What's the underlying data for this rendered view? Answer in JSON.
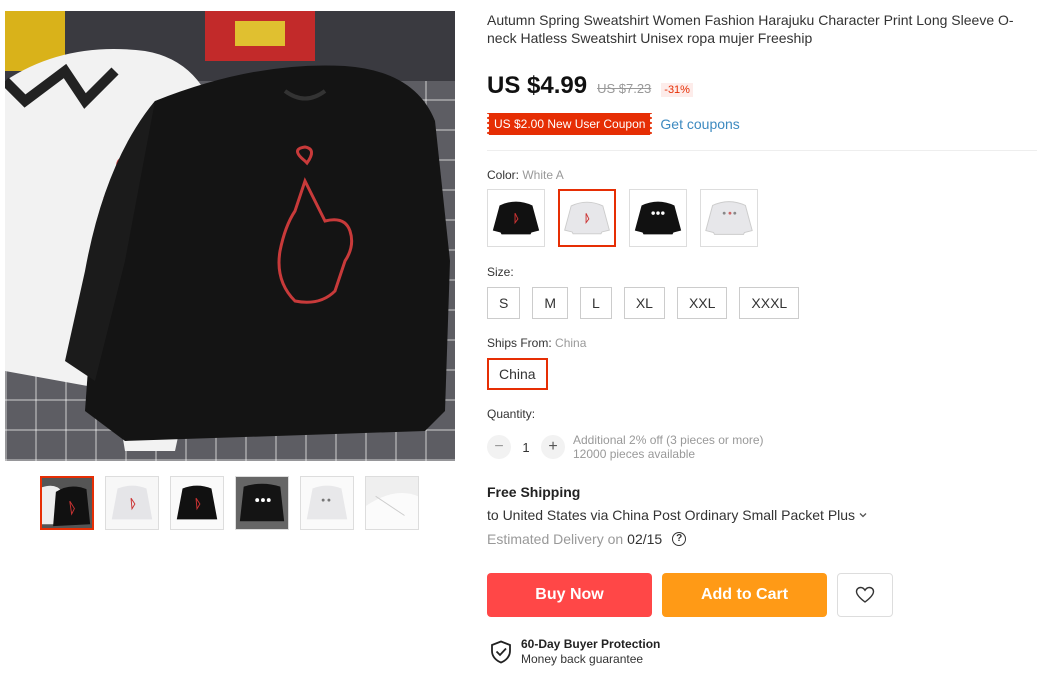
{
  "product": {
    "title": "Autumn Spring Sweatshirt Women Fashion Harajuku Character Print Long Sleeve O-neck Hatless Sweatshirt Unisex ropa mujer Freeship"
  },
  "price": {
    "current": "US $4.99",
    "original": "US $7.23",
    "discount": "-31%"
  },
  "coupon": {
    "tag": "US $2.00 New User Coupon",
    "link": "Get coupons"
  },
  "color": {
    "label": "Color:",
    "selected": "White A",
    "options": [
      "black-heart",
      "white-a",
      "black-print",
      "white-print"
    ]
  },
  "size": {
    "label": "Size:",
    "options": [
      "S",
      "M",
      "L",
      "XL",
      "XXL",
      "XXXL"
    ]
  },
  "ships_from": {
    "label": "Ships From:",
    "selected": "China",
    "option": "China"
  },
  "quantity": {
    "label": "Quantity:",
    "value": "1",
    "minus": "−",
    "plus": "+",
    "discount_note": "Additional 2% off (3 pieces or more)",
    "available": "12000 pieces available"
  },
  "shipping": {
    "title": "Free Shipping",
    "detail": "to United States via China Post Ordinary Small Packet Plus",
    "estimated_prefix": "Estimated Delivery on",
    "estimated_date": "02/15",
    "help": "?"
  },
  "actions": {
    "buy_now": "Buy Now",
    "add_to_cart": "Add to Cart"
  },
  "protection": {
    "title": "60-Day Buyer Protection",
    "subtitle": "Money back guarantee"
  },
  "colors": {
    "accent": "#e62e04",
    "buy_now": "#ff4747",
    "add_to_cart": "#ff9a16",
    "link": "#3d8ac0"
  },
  "icons": {
    "dropdown": "chevron-down-icon",
    "wishlist": "heart-icon",
    "protection": "shield-check-icon"
  }
}
